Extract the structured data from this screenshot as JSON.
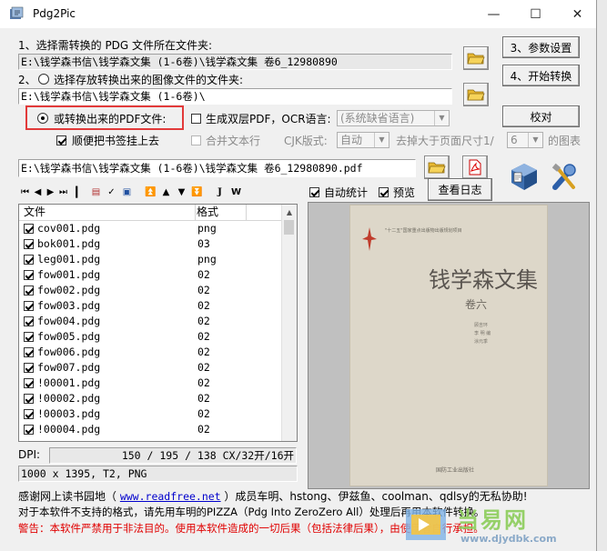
{
  "window": {
    "title": "Pdg2Pic",
    "minimize_glyph": "—",
    "maximize_glyph": "☐",
    "close_glyph": "✕"
  },
  "step1": {
    "label": "1、选择需转换的 PDG 文件所在文件夹:",
    "path": "E:\\钱学森书信\\钱学森文集 (1-6卷)\\钱学森文集  卷6_12980890"
  },
  "step2": {
    "label": "选择存放转换出来的图像文件的文件夹:",
    "prefix": "2、",
    "path": "E:\\钱学森书信\\钱学森文集 (1-6卷)\\"
  },
  "options": {
    "pdf_radio_label": "或转换出来的PDF文件:",
    "bookmark_label": "顺便把书签挂上去",
    "dual_layer_label": "生成双层PDF，OCR语言:",
    "ocr_language": "(系统缺省语言)",
    "merge_text_label": "合并文本行",
    "cjk_label": "CJK版式:",
    "cjk_value": "自动",
    "remove_label": "去掉大于页面尺寸1/",
    "remove_value": "6",
    "remove_suffix": "的图表"
  },
  "pdf_path": "E:\\钱学森书信\\钱学森文集 (1-6卷)\\钱学森文集  卷6_12980890.pdf",
  "buttons": {
    "params": "3、参数设置",
    "start": "4、开始转换",
    "proof": "校对",
    "log": "查看日志"
  },
  "toggles": {
    "auto_stats": "自动统计",
    "preview": "预览"
  },
  "file_list": {
    "headers": [
      "文件",
      "格式"
    ],
    "rows": [
      {
        "name": "cov001.pdg",
        "format": "png"
      },
      {
        "name": "bok001.pdg",
        "format": "03"
      },
      {
        "name": "leg001.pdg",
        "format": "png"
      },
      {
        "name": "fow001.pdg",
        "format": "02"
      },
      {
        "name": "fow002.pdg",
        "format": "02"
      },
      {
        "name": "fow003.pdg",
        "format": "02"
      },
      {
        "name": "fow004.pdg",
        "format": "02"
      },
      {
        "name": "fow005.pdg",
        "format": "02"
      },
      {
        "name": "fow006.pdg",
        "format": "02"
      },
      {
        "name": "fow007.pdg",
        "format": "02"
      },
      {
        "name": "!00001.pdg",
        "format": "02"
      },
      {
        "name": "!00002.pdg",
        "format": "02"
      },
      {
        "name": "!00003.pdg",
        "format": "02"
      },
      {
        "name": "!00004.pdg",
        "format": "02"
      }
    ]
  },
  "dpi": {
    "label": "DPI:",
    "value": "150 / 195 / 138 CX/32开/16开"
  },
  "image_info": "1000 x 1395, T2, PNG",
  "preview_page": {
    "series": "\"十二五\"国家重点出版物出版规划项目",
    "title": "钱学森文集",
    "volume": "卷六",
    "editors": [
      "顾吉环",
      "李 明  编",
      "涂元季"
    ],
    "publisher": "国防工业出版社"
  },
  "footer": {
    "line1_prefix": "感谢网上读书园地（ ",
    "line1_link": "www.readfree.net",
    "line1_suffix": " ）成员车明、hstong、伊兹鱼、coolman、qdlsy的无私协助!",
    "line2": "对于本软件不支持的格式，请先用车明的PIZZA（Pdg Into ZeroZero All）处理后再用本软件转换。",
    "line3": "警告：本软件严禁用于非法目的。使用本软件造成的一切后果（包括法律后果），由使用者自行承担。"
  },
  "watermark": {
    "title": "当易网",
    "url": "www.djydbk.com"
  },
  "colors": {
    "highlight_border": "#e23a3a",
    "warning_text": "#e00000",
    "link": "#0000cc"
  }
}
